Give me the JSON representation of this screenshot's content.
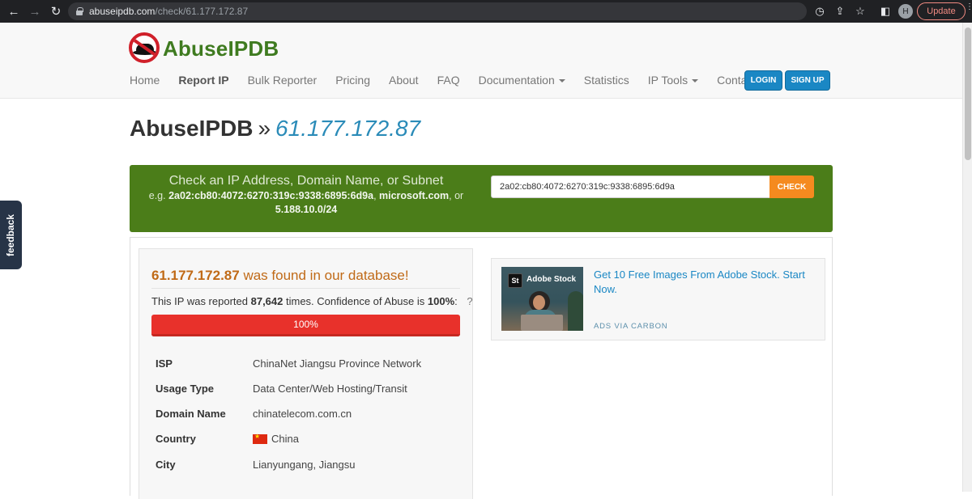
{
  "browser": {
    "url_host": "abuseipdb.com",
    "url_path": "/check/61.177.172.87",
    "profile_initial": "H",
    "update_label": "Update"
  },
  "header": {
    "logo_text": "AbuseIPDB",
    "nav": [
      {
        "label": "Home"
      },
      {
        "label": "Report IP"
      },
      {
        "label": "Bulk Reporter"
      },
      {
        "label": "Pricing"
      },
      {
        "label": "About"
      },
      {
        "label": "FAQ"
      },
      {
        "label": "Documentation"
      },
      {
        "label": "Statistics"
      },
      {
        "label": "IP Tools"
      },
      {
        "label": "Contact"
      }
    ],
    "login_label": "LOGIN",
    "signup_label": "SIGN UP"
  },
  "page": {
    "title_site": "AbuseIPDB",
    "title_sep": "»",
    "title_ip": "61.177.172.87"
  },
  "search": {
    "heading": "Check an IP Address, Domain Name, or Subnet",
    "hint_prefix": "e.g.",
    "hint_ex1": "2a02:cb80:4072:6270:319c:9338:6895:6d9a",
    "hint_ex2": "microsoft.com",
    "hint_or": "or",
    "hint_ex3": "5.188.10.0/24",
    "input_value": "2a02:cb80:4072:6270:319c:9338:6895:6d9a",
    "button_label": "CHECK"
  },
  "result": {
    "ip": "61.177.172.87",
    "found_text": "was found in our database!",
    "reported_prefix": "This IP was reported",
    "report_count": "87,642",
    "reported_mid": "times. Confidence of Abuse is",
    "confidence": "100%",
    "confidence_value": 100,
    "help_mark": "?",
    "details": [
      {
        "label": "ISP",
        "value": "ChinaNet Jiangsu Province Network"
      },
      {
        "label": "Usage Type",
        "value": "Data Center/Web Hosting/Transit"
      },
      {
        "label": "Domain Name",
        "value": "chinatelecom.com.cn"
      },
      {
        "label": "Country",
        "value": "China",
        "flag": "flag-china-icon"
      },
      {
        "label": "City",
        "value": "Lianyungang, Jiangsu"
      }
    ]
  },
  "ad": {
    "brand_badge": "St",
    "brand_name": "Adobe Stock",
    "text": "Get 10 Free Images From Adobe Stock. Start Now.",
    "via": "ADS VIA CARBON"
  },
  "feedback": {
    "label": "feedback"
  },
  "colors": {
    "brand_green": "#3f7b20",
    "search_band": "#4b7d19",
    "accent_blue": "#1a87c4",
    "check_orange": "#f58a1f",
    "danger_red": "#e8312b",
    "found_orange": "#c06a17"
  }
}
